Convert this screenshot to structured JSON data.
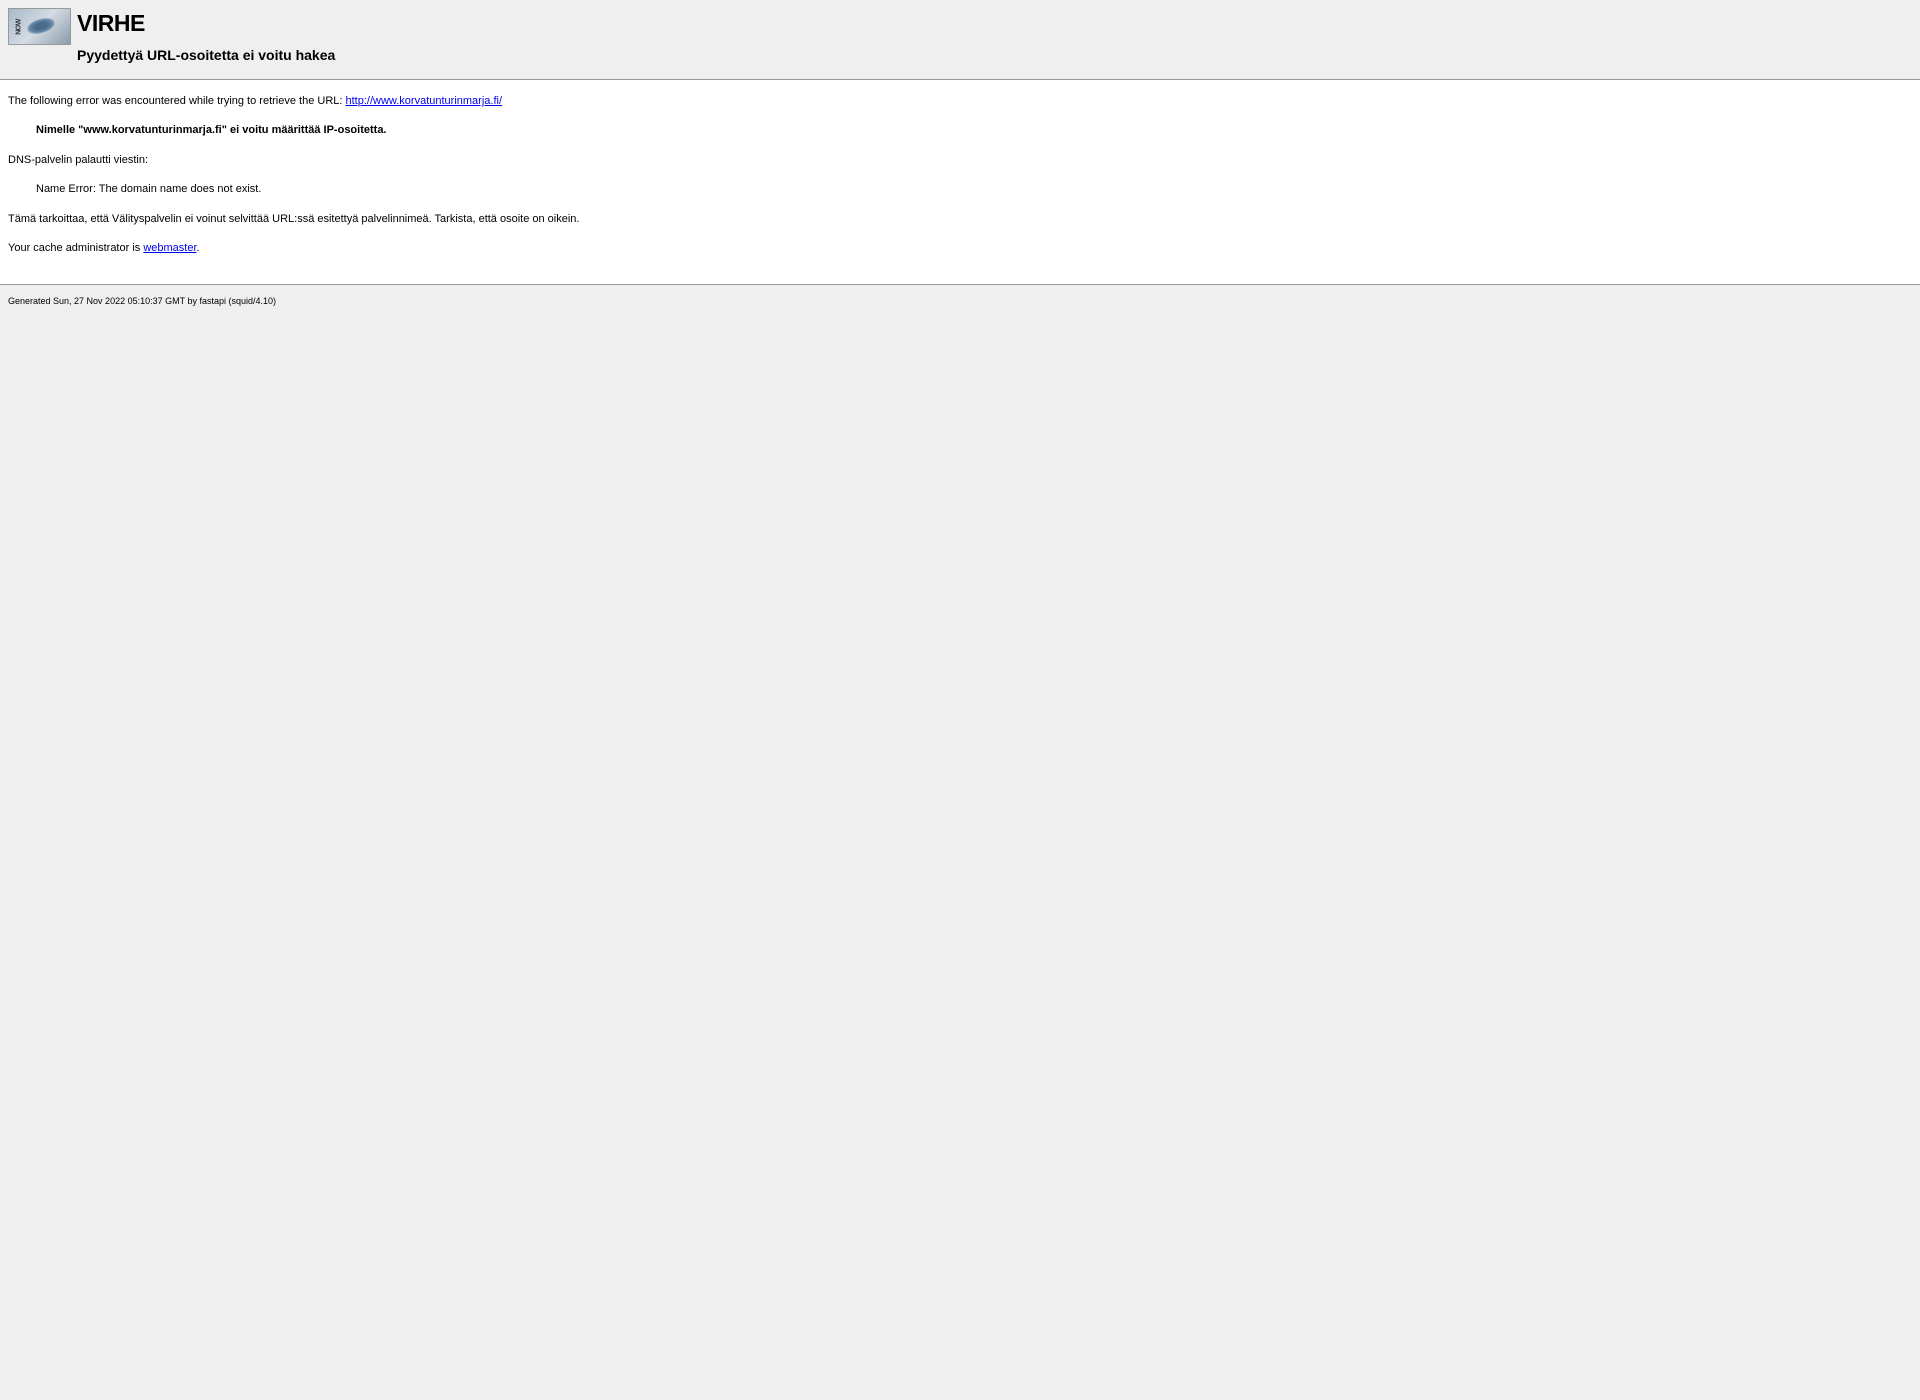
{
  "header": {
    "logo_text": "NOW",
    "title": "VIRHE",
    "subtitle": "Pyydettyä URL-osoitetta ei voitu hakea"
  },
  "content": {
    "error_intro": "The following error was encountered while trying to retrieve the URL: ",
    "url": "http://www.korvatunturinmarja.fi/",
    "dns_error": "Nimelle \"www.korvatunturinmarja.fi\" ei voitu määrittää IP-osoitetta.",
    "dns_server_msg": "DNS-palvelin palautti viestin:",
    "name_error": "Name Error: The domain name does not exist.",
    "explanation": "Tämä tarkoittaa, että Välityspalvelin ei voinut selvittää URL:ssä esitettyä palvelinnimeä. Tarkista, että osoite on oikein.",
    "cache_admin_prefix": "Your cache administrator is ",
    "cache_admin_link": "webmaster",
    "cache_admin_suffix": "."
  },
  "footer": {
    "generated": "Generated Sun, 27 Nov 2022 05:10:37 GMT by fastapi (squid/4.10)"
  }
}
